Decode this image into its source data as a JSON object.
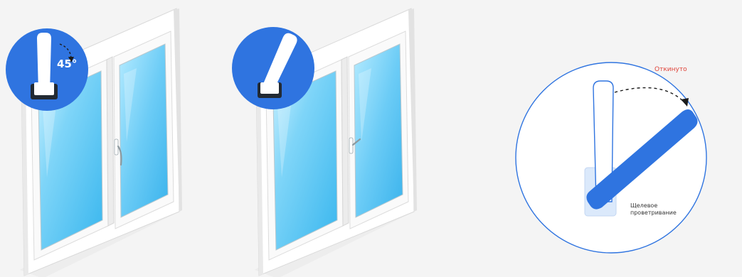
{
  "scene_1": {
    "badge_angle": "45°"
  },
  "scene_2": {},
  "detail": {
    "tilt_label": "Откинуто",
    "vent_label_line1": "Щелевое",
    "vent_label_line2": "проветривание"
  },
  "colors": {
    "accent_blue": "#2f74e0",
    "glass_light": "#9fe0fb",
    "glass_mid": "#4fc1f2",
    "frame_white": "#ffffff",
    "background": "#f4f4f4",
    "arrow_red": "#e0453b"
  },
  "icons": [
    "handle-vertical-icon",
    "handle-tilted-icon",
    "rotation-arrow-icon"
  ]
}
